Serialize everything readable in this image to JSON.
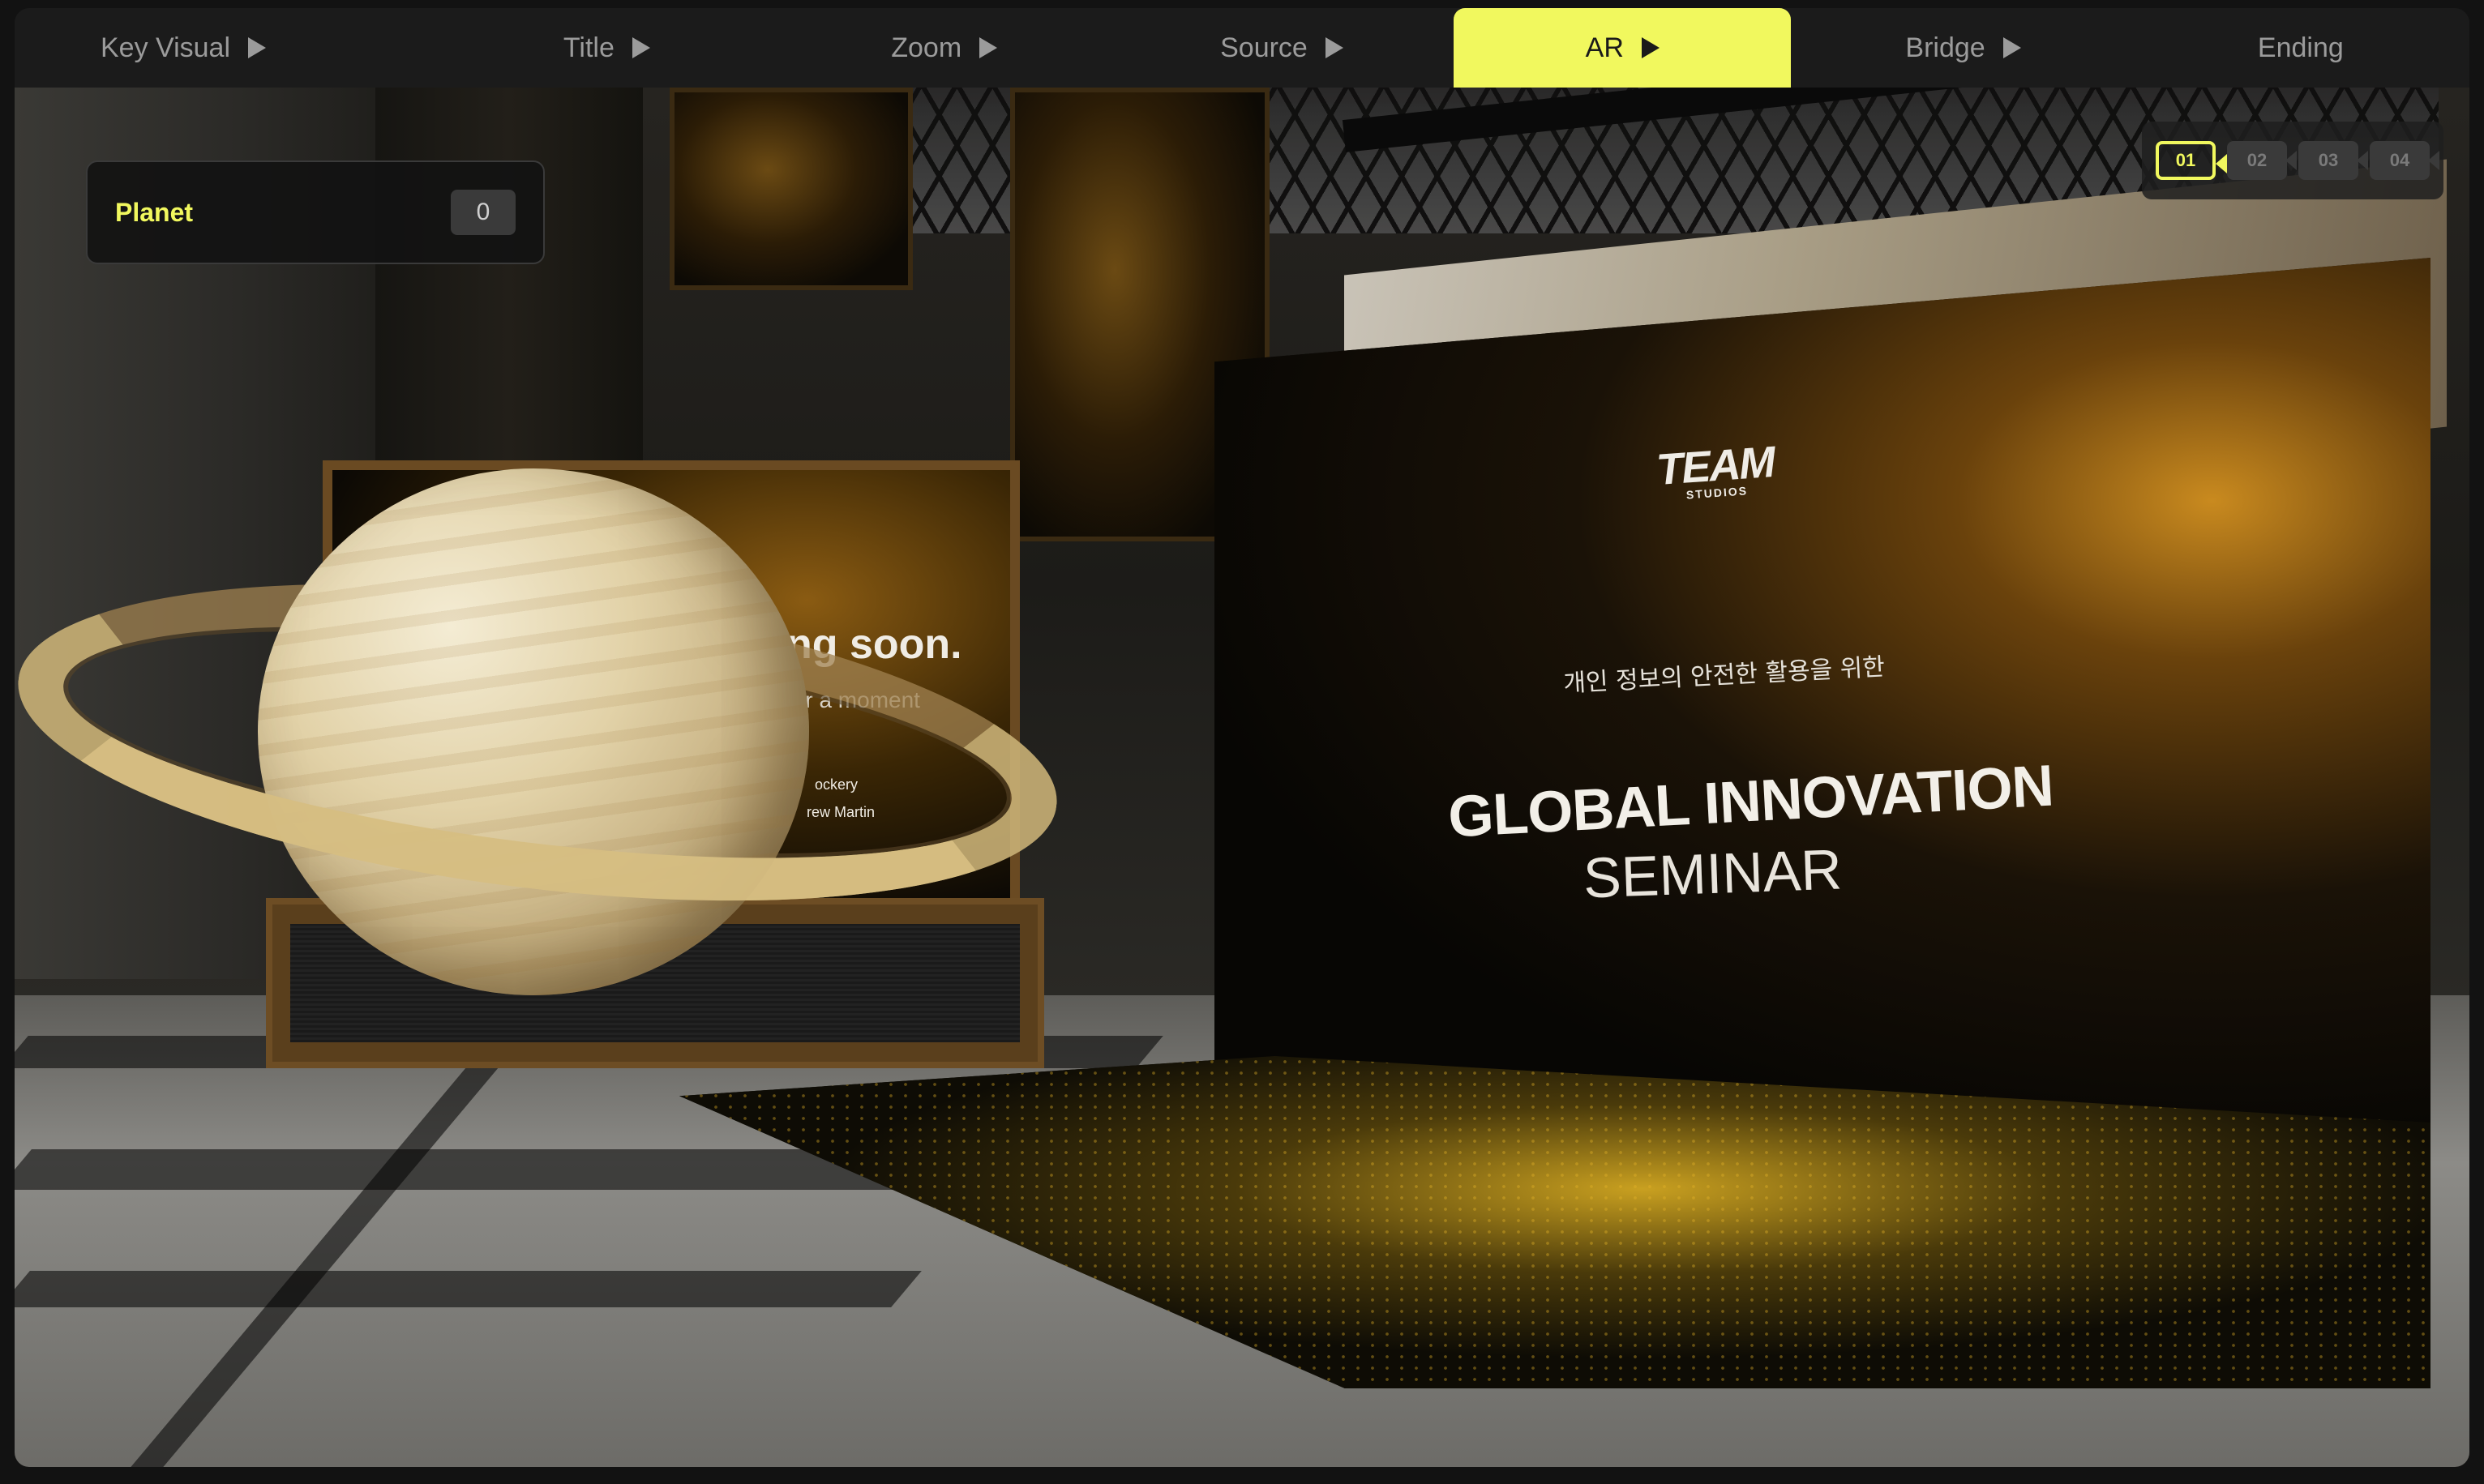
{
  "tabs": [
    {
      "label": "Key Visual",
      "active": false,
      "has_play": true
    },
    {
      "label": "Title",
      "active": false,
      "has_play": true
    },
    {
      "label": "Zoom",
      "active": false,
      "has_play": true
    },
    {
      "label": "Source",
      "active": false,
      "has_play": true
    },
    {
      "label": "AR",
      "active": true,
      "has_play": true
    },
    {
      "label": "Bridge",
      "active": false,
      "has_play": true
    },
    {
      "label": "Ending",
      "active": false,
      "has_play": false
    }
  ],
  "planet_panel": {
    "label": "Planet",
    "count": "0"
  },
  "cameras": [
    {
      "label": "01",
      "active": true
    },
    {
      "label": "02",
      "active": false
    },
    {
      "label": "03",
      "active": false
    },
    {
      "label": "04",
      "active": false
    }
  ],
  "scene": {
    "left_display": {
      "headline": "ng soon.",
      "subline": "for a moment",
      "name1": "ockery",
      "name2": "rew Martin"
    },
    "main_screen": {
      "logo": "TEAM",
      "logo_sub": "STUDIOS",
      "korean_line": "개인 정보의 안전한 활용을 위한",
      "title": "GLOBAL INNOVATION",
      "subtitle": "SEMINAR"
    }
  },
  "colors": {
    "accent": "#f1f85e",
    "tab_text": "#9b9b9b",
    "panel_bg": "#121212"
  }
}
